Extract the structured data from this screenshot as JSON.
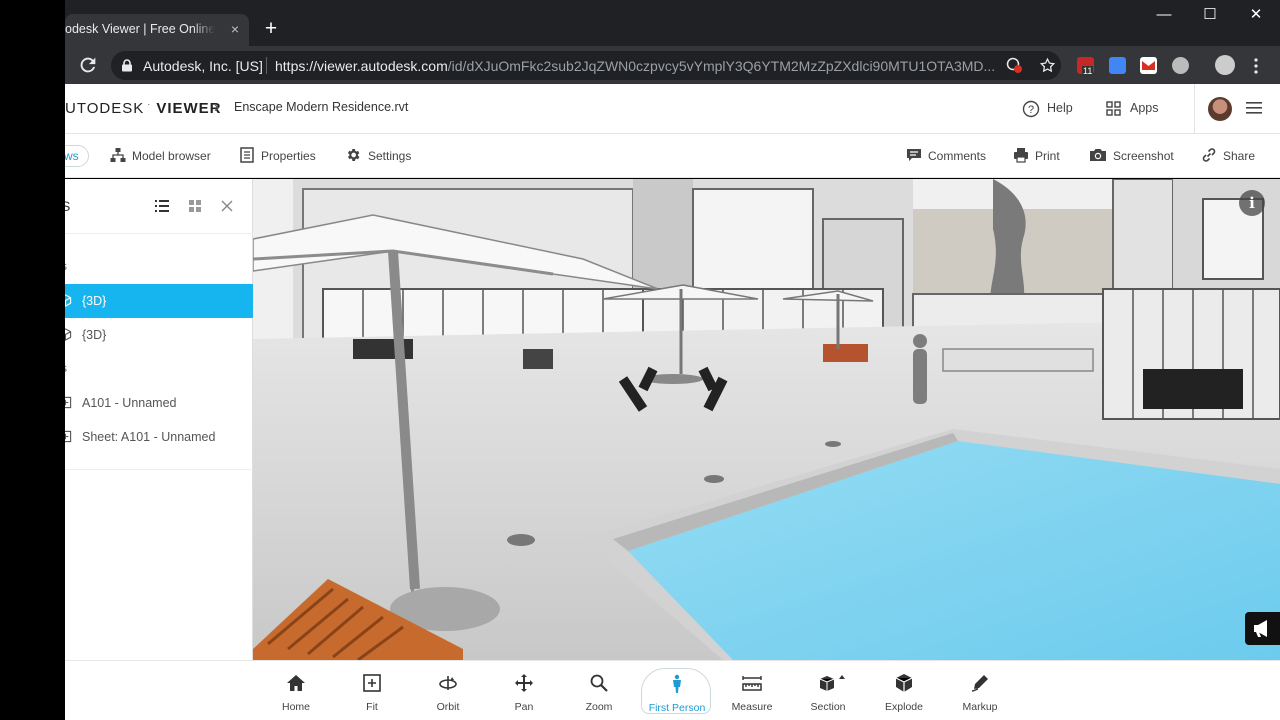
{
  "browser": {
    "tab_title": "odesk Viewer | Free Online Fil",
    "tab_close": "×",
    "new_tab": "+",
    "win_minimize": "—",
    "win_maximize": "☐",
    "win_close": "✕",
    "site_owner": "Autodesk, Inc. [US]",
    "url_host": "https://viewer.autodesk.com",
    "url_path": "/id/dXJuOmFkc2sub2JqZWN0czpvcy5vYmplY3Q6YTM2MzZpZXdlci90MTU1OTA3MD...",
    "ext_badge_1": "11"
  },
  "header": {
    "brand_light": "UTODESK",
    "brand_bold": "VIEWER",
    "file_name": "Enscape Modern Residence.rvt",
    "help_label": "Help",
    "apps_label": "Apps"
  },
  "toolbar": {
    "views_label": "ws",
    "model_browser": "Model browser",
    "properties": "Properties",
    "settings": "Settings",
    "comments": "Comments",
    "print": "Print",
    "screenshot": "Screenshot",
    "share": "Share"
  },
  "panel": {
    "title": "S",
    "group_3d": "s",
    "group_2d": "s",
    "items_3d": [
      {
        "label": "{3D}",
        "selected": true
      },
      {
        "label": "{3D}",
        "selected": false
      }
    ],
    "items_2d": [
      {
        "label": "A101 - Unnamed"
      },
      {
        "label": "Sheet: A101 - Unnamed"
      }
    ]
  },
  "viewport": {
    "info_glyph": "i"
  },
  "nav": {
    "home": "Home",
    "fit": "Fit",
    "orbit": "Orbit",
    "pan": "Pan",
    "zoom": "Zoom",
    "first_person": "First Person",
    "measure": "Measure",
    "section": "Section",
    "explode": "Explode",
    "markup": "Markup",
    "active": "first_person"
  },
  "colors": {
    "accent": "#1e9bd7",
    "selection": "#16b5f0",
    "pool": "#7fd3ef"
  }
}
